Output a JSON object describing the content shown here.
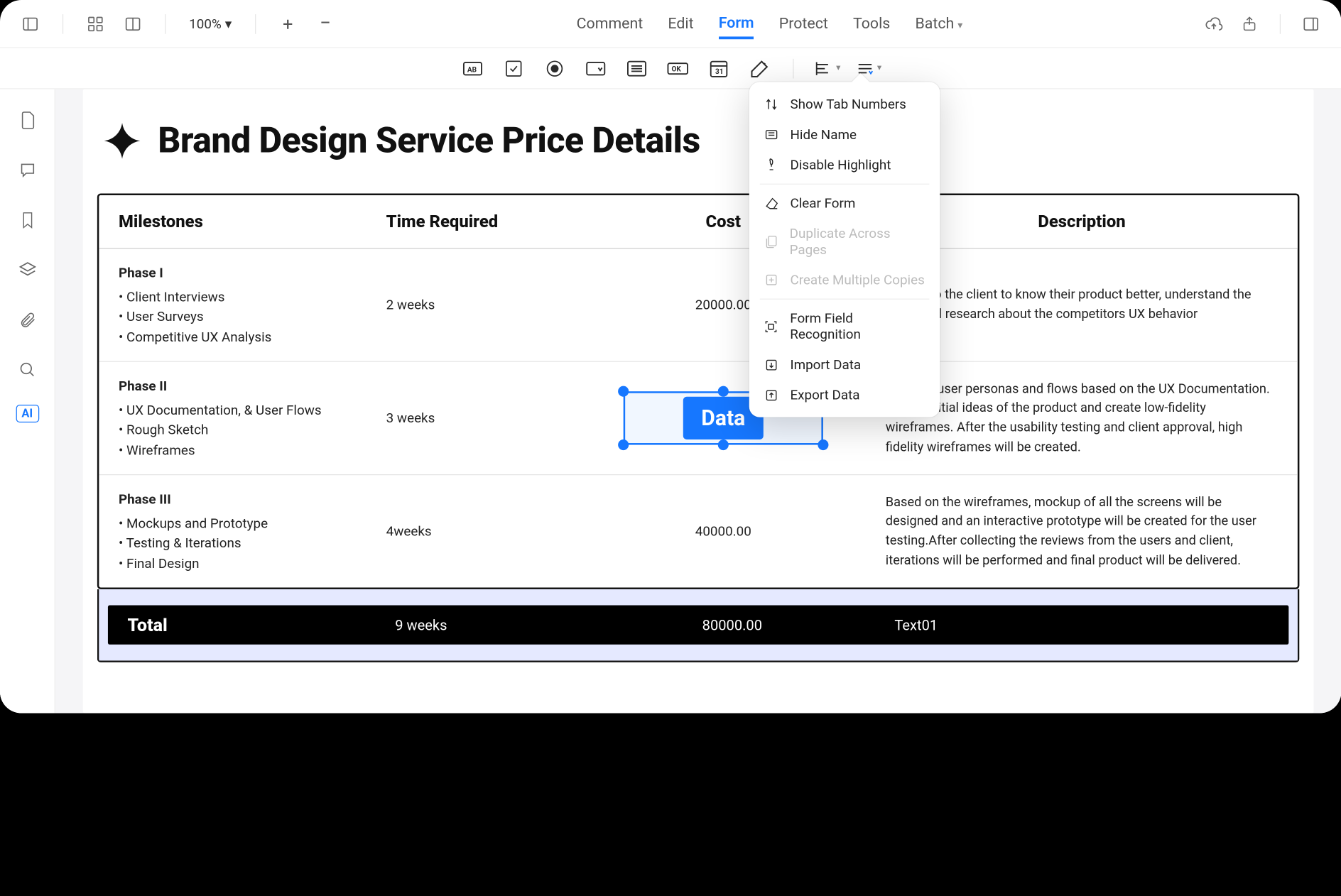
{
  "toolbar": {
    "zoom": "100%",
    "menu": [
      "Comment",
      "Edit",
      "Form",
      "Protect",
      "Tools",
      "Batch"
    ],
    "activeMenu": "Form"
  },
  "leftRail": {
    "ai": "AI"
  },
  "document": {
    "title": "Brand Design Service Price Details",
    "columns": [
      "Milestones",
      "Time Required",
      "Cost",
      "Description"
    ],
    "rows": [
      {
        "phase": "Phase I",
        "items": [
          "Client Interviews",
          "User Surveys",
          "Competitive UX Analysis"
        ],
        "time": "2 weeks",
        "cost": "20000.00",
        "desc": "Talking to the client to know their product better, understand the users and research about the competitors UX behavior"
      },
      {
        "phase": "Phase II",
        "items": [
          "UX Documentation, & User Flows",
          "Rough Sketch",
          "Wireframes"
        ],
        "time": "3 weeks",
        "cost": "",
        "desc": "Creating user personas and flows based on the UX Documentation. Sketch initial ideas of the product and create low-fidelity wireframes. After the usability testing and client approval, high fidelity wireframes will be created."
      },
      {
        "phase": "Phase III",
        "items": [
          "Mockups and Prototype",
          "Testing & Iterations",
          "Final Design"
        ],
        "time": "4weeks",
        "cost": "40000.00",
        "desc": "Based on the wireframes, mockup of all the screens will be designed and an interactive prototype will be created for the user testing.After collecting the reviews from the users and client, iterations will be performed and final product will be delivered."
      }
    ],
    "fieldBadge": "Data",
    "total": {
      "label": "Total",
      "time": "9 weeks",
      "cost": "80000.00",
      "desc": "Text01"
    }
  },
  "dropdown": {
    "items": [
      {
        "label": "Show Tab Numbers",
        "icon": "tabnum",
        "enabled": true
      },
      {
        "label": "Hide Name",
        "icon": "hidename",
        "enabled": true
      },
      {
        "label": "Disable Highlight",
        "icon": "highlight",
        "enabled": true,
        "sepAfter": true
      },
      {
        "label": "Clear Form",
        "icon": "eraser",
        "enabled": true
      },
      {
        "label": "Duplicate Across Pages",
        "icon": "duplicate",
        "enabled": false
      },
      {
        "label": "Create Multiple Copies",
        "icon": "copies",
        "enabled": false,
        "sepAfter": true
      },
      {
        "label": "Form Field Recognition",
        "icon": "recognize",
        "enabled": true
      },
      {
        "label": "Import Data",
        "icon": "import",
        "enabled": true
      },
      {
        "label": "Export Data",
        "icon": "export",
        "enabled": true
      }
    ]
  }
}
